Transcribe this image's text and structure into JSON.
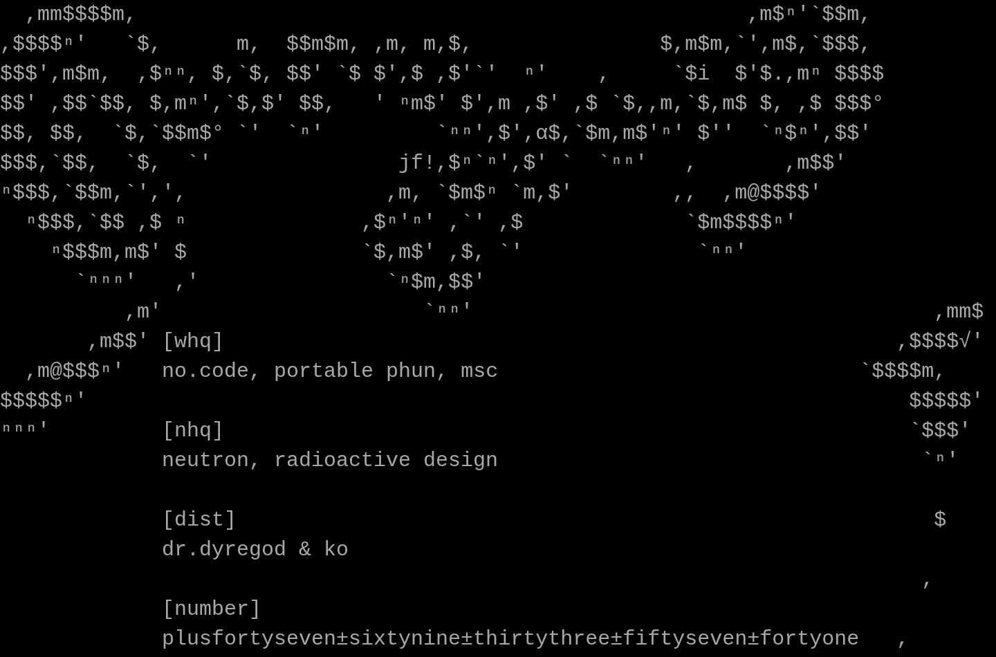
{
  "screen": {
    "rows": [
      {
        "kind": "line",
        "segments": [
          {
            "art": "  ,mm$$$$m,"
          },
          {
            "art": "                                                 ,m$ⁿ'`$$m,"
          }
        ]
      },
      {
        "kind": "line",
        "segments": [
          {
            "art": ",$$$$ⁿ'   `$,      m,  $$m$m, ,m, m,$,"
          },
          {
            "art": "               $,m$m,`',m$,`$$$,"
          }
        ]
      },
      {
        "kind": "line",
        "segments": [
          {
            "art": "$$$',m$m,  ,$ⁿⁿ, $,`$, $$' `$ $',$ ,$'`'"
          },
          {
            "art": "  ⁿ'"
          },
          {
            "art": "    ,"
          },
          {
            "art": "     `$i  $'$.,mⁿ $$$$"
          }
        ]
      },
      {
        "kind": "line",
        "segments": [
          {
            "art": "$$' ,$$`$$, $,mⁿ',`$,$' $$,   ' ⁿm$' $',m ,$'"
          },
          {
            "art": " ,$ `$,,m,`$,m$ $, ,$ $$$°"
          }
        ]
      },
      {
        "kind": "line",
        "segments": [
          {
            "art": "$$, $$,  `$,`$$m$° `'  `ⁿ'"
          },
          {
            "art": "         `ⁿⁿ',$',α$,`$m,m$'ⁿ' $''  `ⁿ$ⁿ',$$'"
          }
        ]
      },
      {
        "kind": "line",
        "segments": [
          {
            "art": "$$$,`$$,  `$,  `'"
          },
          {
            "art": "               jf!,$ⁿ`ⁿ',$' `  `ⁿⁿ'"
          },
          {
            "art": "   ,"
          },
          {
            "art": "       ,m$$'"
          }
        ]
      },
      {
        "kind": "line",
        "segments": [
          {
            "art": "ⁿ$$$,`$$m,`',',"
          },
          {
            "art": "                ,m, `$m$ⁿ `m,$'"
          },
          {
            "art": "        ,,  ,m@$$$$'"
          }
        ]
      },
      {
        "kind": "line",
        "segments": [
          {
            "art": "  ⁿ$$$,`$$ ,$ ⁿ"
          },
          {
            "art": "              ,$ⁿ'ⁿ' ,`' ,$"
          },
          {
            "art": "             `$m$$$$ⁿ'"
          }
        ]
      },
      {
        "kind": "line",
        "segments": [
          {
            "art": "    ⁿ$$$m,m$' $"
          },
          {
            "art": "              `$,m$' ,$, `'"
          },
          {
            "art": "              `ⁿⁿ'"
          }
        ]
      },
      {
        "kind": "line",
        "segments": [
          {
            "art": "      `ⁿⁿⁿ'   ,'"
          },
          {
            "art": "               `ⁿ$m,$$'"
          }
        ]
      },
      {
        "kind": "line",
        "segments": [
          {
            "art": "          ,m'"
          },
          {
            "art": "                     `ⁿⁿ'"
          },
          {
            "art": "                                     ,mm$"
          }
        ]
      },
      {
        "kind": "line",
        "segments": [
          {
            "art": "       ,m$$'"
          },
          {
            "heading": " [whq]"
          },
          {
            "art": "                                                      ,$$$$√'"
          }
        ]
      },
      {
        "kind": "line",
        "segments": [
          {
            "art": "  ,m@$$$ⁿ'"
          },
          {
            "text": "   no.code, portable phun, msc"
          },
          {
            "art": "                             `$$$$m,"
          }
        ]
      },
      {
        "kind": "line",
        "segments": [
          {
            "art": "$$$$$ⁿ'"
          },
          {
            "art": "                                                                  $$$$$'"
          }
        ]
      },
      {
        "kind": "line",
        "segments": [
          {
            "art": "ⁿⁿⁿ'"
          },
          {
            "heading": "         [nhq]"
          },
          {
            "art": "                                                       `$$$'"
          }
        ]
      },
      {
        "kind": "line",
        "segments": [
          {
            "text": "             neutron, radioactive design"
          },
          {
            "art": "                                  `ⁿ'"
          }
        ]
      },
      {
        "kind": "blank"
      },
      {
        "kind": "line",
        "segments": [
          {
            "heading": "             [dist]"
          },
          {
            "art": "                                                        $"
          }
        ]
      },
      {
        "kind": "line",
        "segments": [
          {
            "text": "             dr.dyregod & ko"
          }
        ]
      },
      {
        "kind": "line",
        "segments": [
          {
            "art": "                                                                          ,"
          }
        ]
      },
      {
        "kind": "line",
        "segments": [
          {
            "heading": "             [number]"
          }
        ]
      },
      {
        "kind": "line",
        "segments": [
          {
            "text": "             plusfortyseven±sixtynine±thirtythree±fiftyseven±fortyone"
          },
          {
            "art": "   ,"
          }
        ]
      }
    ]
  }
}
